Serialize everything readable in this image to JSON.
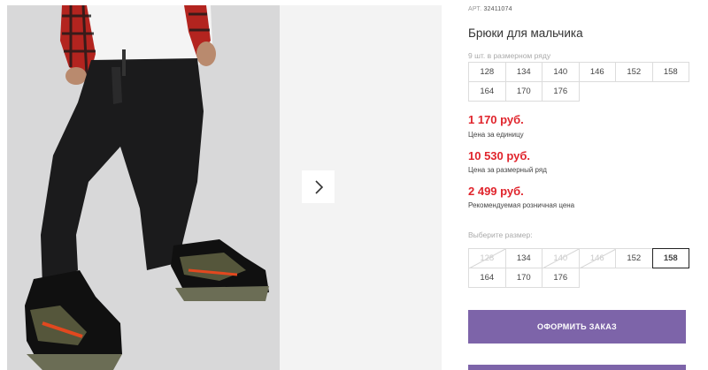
{
  "product": {
    "article_label": "АРТ.",
    "article_number": "32411074",
    "title": "Брюки для мальчика"
  },
  "pack": {
    "caption": "9 шт. в размерном ряду",
    "sizes": [
      "128",
      "134",
      "140",
      "146",
      "152",
      "158",
      "164",
      "170",
      "176"
    ]
  },
  "prices": {
    "unit_price": "1 170 руб.",
    "unit_label": "Цена за единицу",
    "pack_price": "10 530 руб.",
    "pack_label": "Цена за размерный ряд",
    "retail_price": "2 499 руб.",
    "retail_label": "Рекомендуемая розничная цена"
  },
  "size_select": {
    "label": "Выберите размер:",
    "sizes": [
      "128",
      "134",
      "140",
      "146",
      "152",
      "158",
      "164",
      "170",
      "176"
    ],
    "unavailable": [
      "128",
      "140",
      "146"
    ],
    "selected": "158"
  },
  "actions": {
    "order_label": "ОФОРМИТЬ ЗАКАЗ"
  },
  "colors": {
    "accent_button": "#7d64a9",
    "price_red": "#e0242c"
  },
  "icons": {
    "gallery_next": "chevron-right-icon"
  }
}
